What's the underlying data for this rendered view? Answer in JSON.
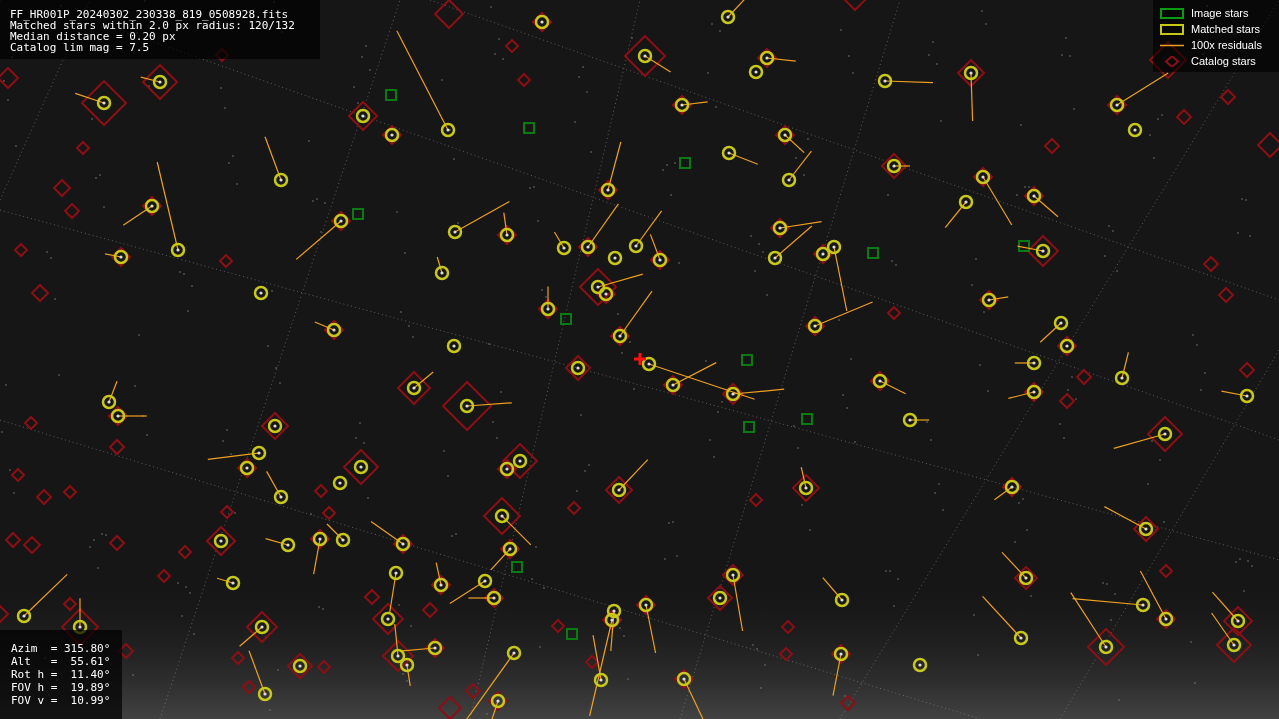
{
  "info": {
    "lines": [
      "FF_HR001P_20240302_230338_819_0508928.fits",
      "Matched stars within 2.0 px radius: 120/132",
      "Median distance = 0.20 px",
      "Catalog lim mag = 7.5"
    ]
  },
  "legend": [
    {
      "kind": "image",
      "label": "Image stars"
    },
    {
      "kind": "matched",
      "label": "Matched stars"
    },
    {
      "kind": "residual",
      "label": "100x residuals"
    },
    {
      "kind": "catalog",
      "label": "Catalog stars"
    }
  ],
  "pointing": {
    "lines": [
      "Azim  = 315.80°",
      "Alt   =  55.61°",
      "Rot h =  11.40°",
      "FOV h =  19.89°",
      "FOV v =  10.99°"
    ]
  }
}
